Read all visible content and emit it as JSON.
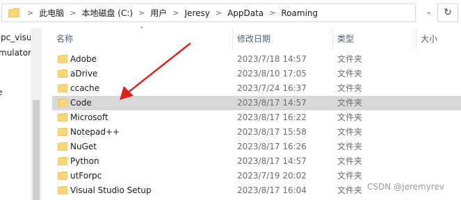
{
  "address": {
    "crumbs": [
      "此电脑",
      "本地磁盘 (C:)",
      "用户",
      "Jeresy",
      "AppData",
      "Roaming"
    ],
    "separator": ">"
  },
  "nav": {
    "items": [
      "pc_visu",
      "mulator",
      "e"
    ]
  },
  "columns": {
    "name": "名称",
    "date": "修改日期",
    "type": "类型",
    "size": "大小"
  },
  "rows": [
    {
      "name": "Adobe",
      "date": "2023/7/18 14:57",
      "type": "文件夹"
    },
    {
      "name": "aDrive",
      "date": "2023/8/10 17:05",
      "type": "文件夹"
    },
    {
      "name": "ccache",
      "date": "2023/7/24 16:37",
      "type": "文件夹"
    },
    {
      "name": "Code",
      "date": "2023/8/17 14:57",
      "type": "文件夹"
    },
    {
      "name": "Microsoft",
      "date": "2023/8/17 16:22",
      "type": "文件夹"
    },
    {
      "name": "Notepad++",
      "date": "2023/8/17 15:58",
      "type": "文件夹"
    },
    {
      "name": "NuGet",
      "date": "2023/8/17 16:26",
      "type": "文件夹"
    },
    {
      "name": "Python",
      "date": "2023/8/17 14:57",
      "type": "文件夹"
    },
    {
      "name": "utForpc",
      "date": "2023/7/19 20:02",
      "type": "文件夹"
    },
    {
      "name": "Visual Studio Setup",
      "date": "2023/8/17 16:04",
      "type": "文件夹"
    }
  ],
  "watermark": "CSDN @Jeremyrev",
  "colors": {
    "folder": "#f8d775",
    "folder_dark": "#e8b84a",
    "hover_row": "#d9d9d9",
    "annotation_arrow": "#e0201c"
  },
  "highlighted_row": "Code"
}
